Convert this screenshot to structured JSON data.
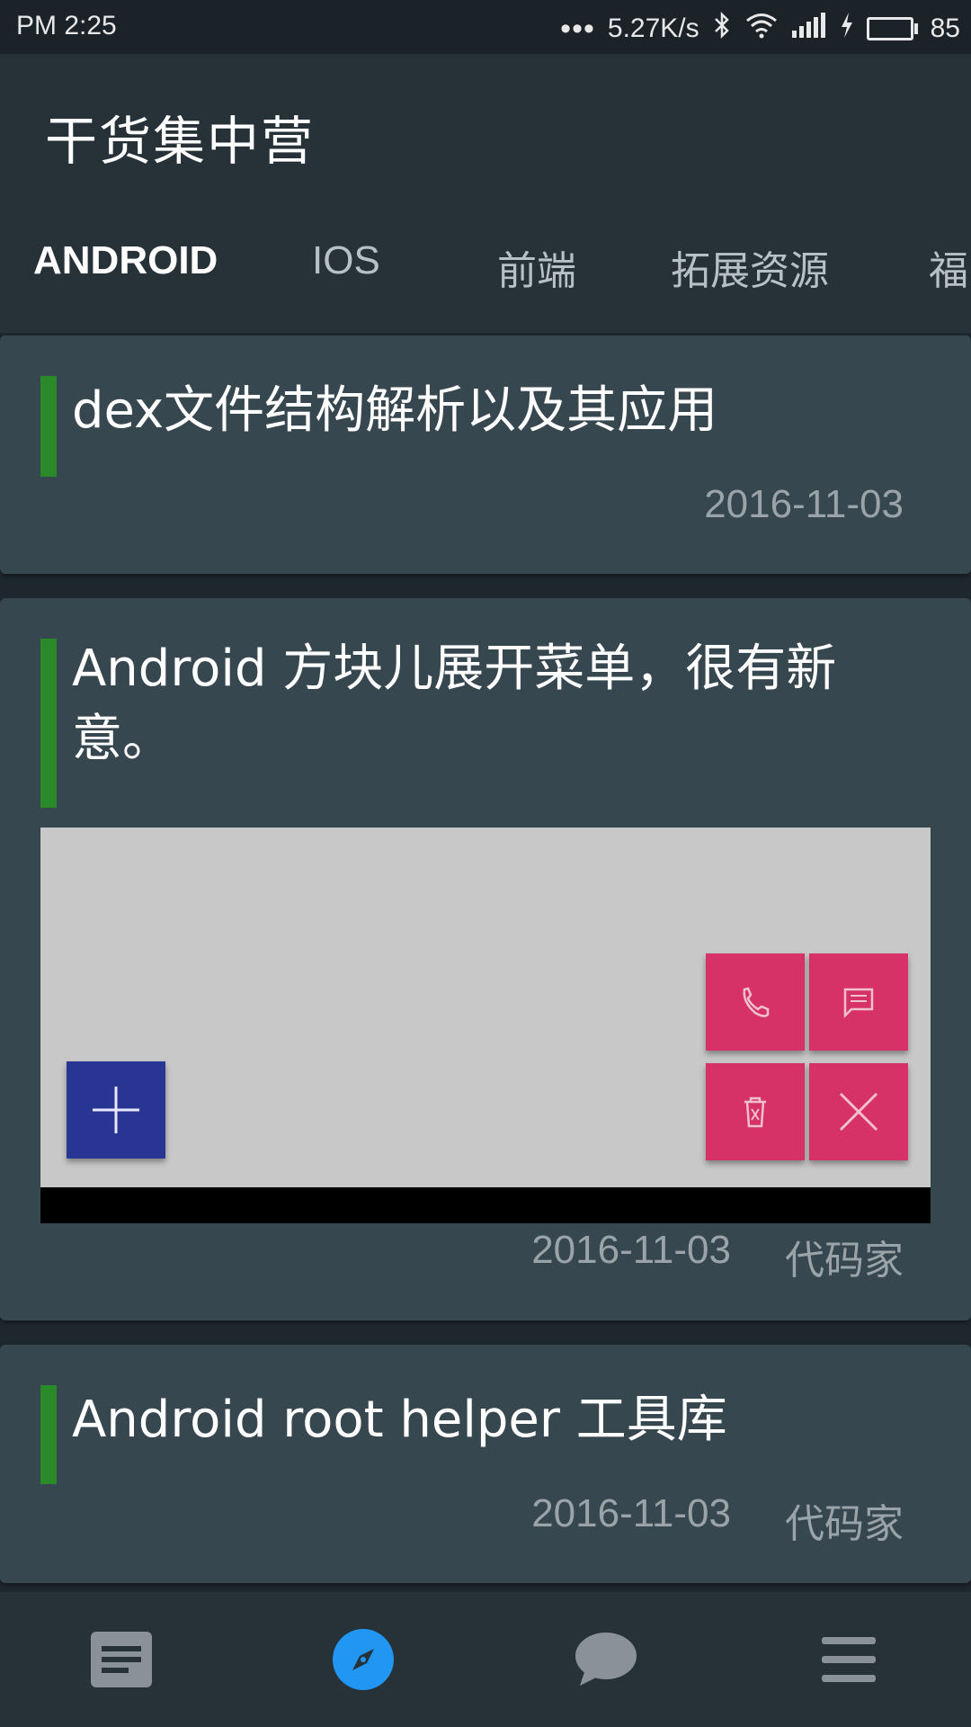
{
  "status_bar": {
    "time": "PM  2:25",
    "network_speed": "5.27K/s",
    "battery_percent": "85",
    "battery_level": 0.85
  },
  "app": {
    "title": "干货集中营"
  },
  "tabs": [
    {
      "label": "ANDROID",
      "active": true
    },
    {
      "label": "IOS",
      "active": false
    },
    {
      "label": "前端",
      "active": false
    },
    {
      "label": "拓展资源",
      "active": false
    },
    {
      "label": "福",
      "active": false
    }
  ],
  "articles": [
    {
      "title": "dex文件结构解析以及其应用",
      "date": "2016-11-03",
      "author": ""
    },
    {
      "title": "Android 方块儿展开菜单，很有新意。",
      "date": "2016-11-03",
      "author": "代码家"
    },
    {
      "title": "Android root helper 工具库",
      "date": "2016-11-03",
      "author": "代码家"
    }
  ],
  "bottom_nav": [
    {
      "icon": "article-icon",
      "active": false
    },
    {
      "icon": "compass-icon",
      "active": true
    },
    {
      "icon": "chat-icon",
      "active": false
    },
    {
      "icon": "menu-icon",
      "active": false
    }
  ],
  "colors": {
    "app_bar": "#263238",
    "card": "#37474f",
    "accent_bar": "#2a8a2a",
    "nav_active": "#2196f3"
  }
}
